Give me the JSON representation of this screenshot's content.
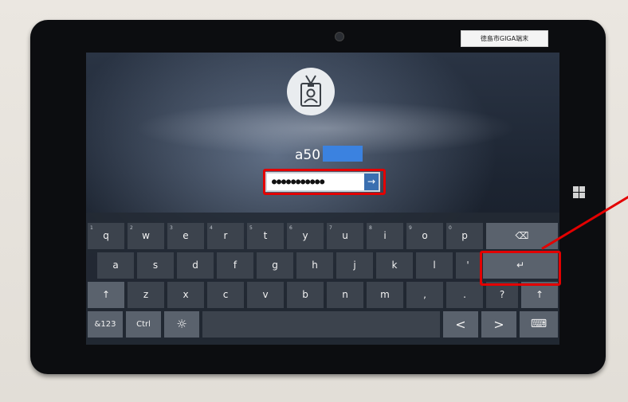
{
  "sticker": {
    "text": "徳島市GIGA端末"
  },
  "login": {
    "username_visible": "a50",
    "password_placeholder": "",
    "password_value": "●●●●●●●●●●●",
    "submit_icon": "→"
  },
  "keyboard": {
    "row1": [
      {
        "label": "q",
        "sub": "1"
      },
      {
        "label": "w",
        "sub": "2"
      },
      {
        "label": "e",
        "sub": "3"
      },
      {
        "label": "r",
        "sub": "4"
      },
      {
        "label": "t",
        "sub": "5"
      },
      {
        "label": "y",
        "sub": "6"
      },
      {
        "label": "u",
        "sub": "7"
      },
      {
        "label": "i",
        "sub": "8"
      },
      {
        "label": "o",
        "sub": "9"
      },
      {
        "label": "p",
        "sub": "0"
      }
    ],
    "backspace": "⌫",
    "row2": [
      "a",
      "s",
      "d",
      "f",
      "g",
      "h",
      "j",
      "k",
      "l",
      "'"
    ],
    "enter": "↵",
    "row3": [
      "↑",
      "z",
      "x",
      "c",
      "v",
      "b",
      "n",
      "m",
      ",",
      ".",
      "?",
      "↑"
    ],
    "row4": {
      "symbols": "&123",
      "ctrl": "Ctrl",
      "emoji": "☼",
      "left": "<",
      "right": ">",
      "keyboard_icon": "⌨"
    }
  },
  "colors": {
    "highlight": "#e30000",
    "username_mask": "#3b82e0",
    "submit": "#3a6fb0"
  }
}
